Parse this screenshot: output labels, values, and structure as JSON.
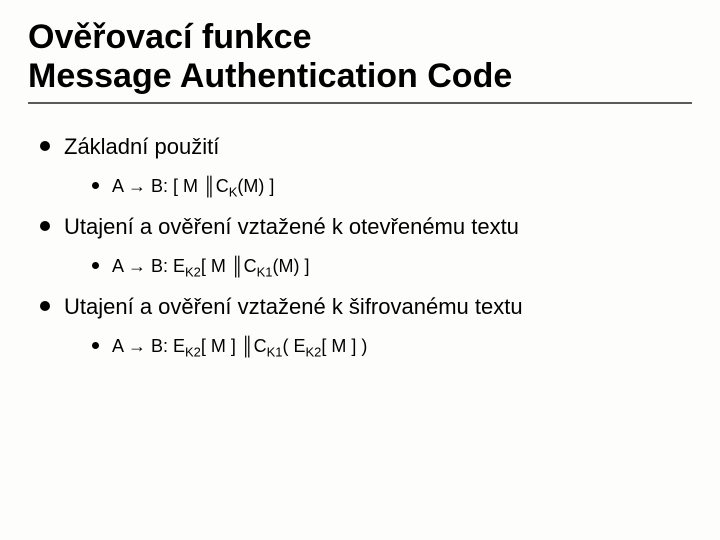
{
  "title_line1": "Ověřovací funkce",
  "title_line2": "Message Authentication Code",
  "items": [
    {
      "label": "Základní použití",
      "sub": {
        "prefix": "A → B: [ M ║C",
        "sub1": "K",
        "mid": "(M) ]",
        "sub2": "",
        "after": "",
        "sub3": "",
        "tail": ""
      }
    },
    {
      "label": "Utajení a ověření vztažené k otevřenému textu",
      "sub": {
        "prefix": "A → B: E",
        "sub1": "K2",
        "mid": "[ M ║C",
        "sub2": "K1",
        "after": "(M) ]",
        "sub3": "",
        "tail": ""
      }
    },
    {
      "label": "Utajení a ověření vztažené k šifrovanému textu",
      "sub": {
        "prefix": "A → B: E",
        "sub1": "K2",
        "mid": "[ M ] ║C",
        "sub2": "K1",
        "after": "( E",
        "sub3": "K2",
        "tail": "[ M ] )"
      }
    }
  ]
}
